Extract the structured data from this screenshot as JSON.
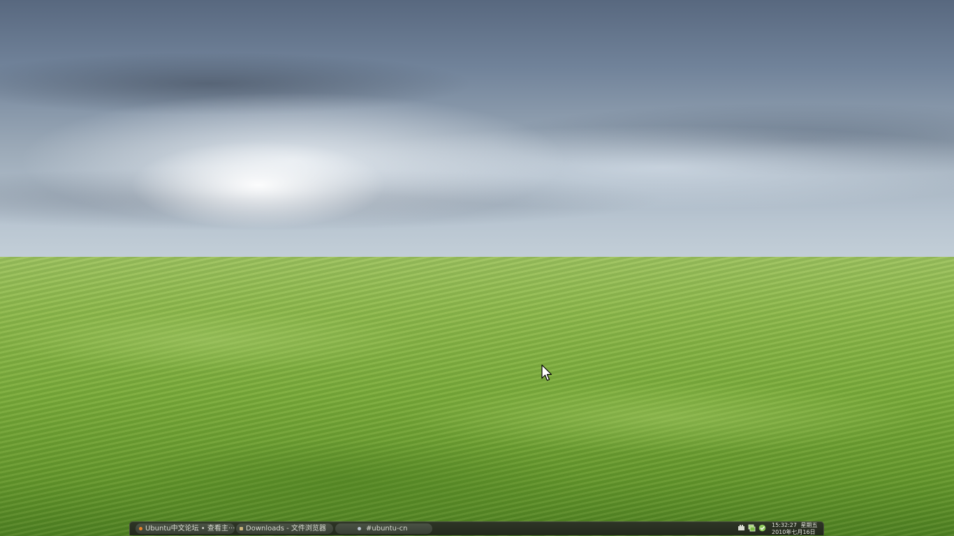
{
  "wallpaper": {
    "description_icon": "wheat-field-wallpaper"
  },
  "taskbar": {
    "tasks": [
      {
        "label": "Ubuntu中文论坛 • 查看主···",
        "icon": "firefox-icon"
      },
      {
        "label": "Downloads - 文件浏览器",
        "icon": "folder-icon"
      },
      {
        "label": "#ubuntu-cn",
        "icon": "irc-chat-icon"
      }
    ],
    "tray_icons": [
      "input-method-icon",
      "network-icon",
      "update-icon"
    ],
    "clock": {
      "time": "15:32:27",
      "weekday": "星期五",
      "date": "2010年七月16日"
    }
  },
  "colors": {
    "panel_bg": "#2a3022",
    "task_bg": "#434a3e",
    "text": "#d9dcd2"
  }
}
